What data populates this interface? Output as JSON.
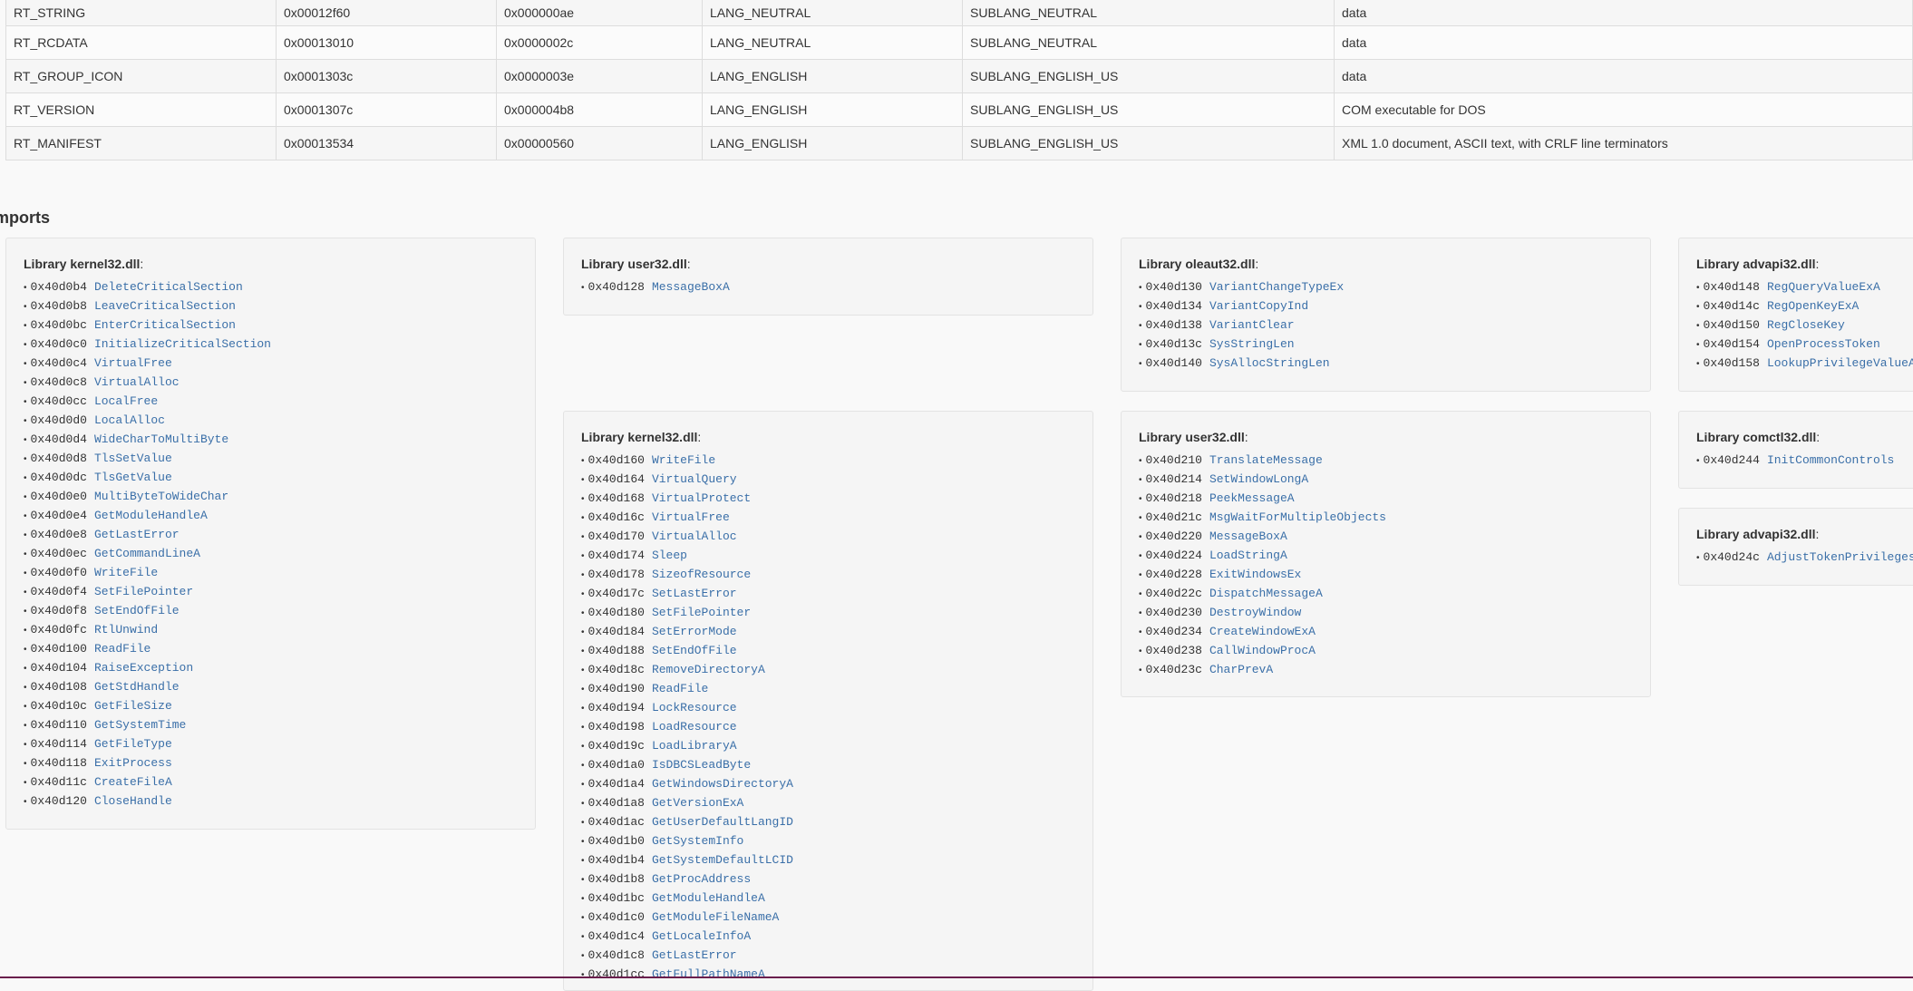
{
  "resources": [
    [
      "RT_STRING",
      "0x00012f60",
      "0x000000ae",
      "LANG_NEUTRAL",
      "SUBLANG_NEUTRAL",
      "data"
    ],
    [
      "RT_RCDATA",
      "0x00013010",
      "0x0000002c",
      "LANG_NEUTRAL",
      "SUBLANG_NEUTRAL",
      "data"
    ],
    [
      "RT_GROUP_ICON",
      "0x0001303c",
      "0x0000003e",
      "LANG_ENGLISH",
      "SUBLANG_ENGLISH_US",
      "data"
    ],
    [
      "RT_VERSION",
      "0x0001307c",
      "0x000004b8",
      "LANG_ENGLISH",
      "SUBLANG_ENGLISH_US",
      "COM executable for DOS"
    ],
    [
      "RT_MANIFEST",
      "0x00013534",
      "0x00000560",
      "LANG_ENGLISH",
      "SUBLANG_ENGLISH_US",
      "XML 1.0 document, ASCII text, with CRLF line terminators"
    ]
  ],
  "imports_heading": "mports",
  "library_prefix": "Library ",
  "libraries": [
    {
      "name": "kernel32.dll",
      "entries": [
        [
          "0x40d0b4",
          "DeleteCriticalSection"
        ],
        [
          "0x40d0b8",
          "LeaveCriticalSection"
        ],
        [
          "0x40d0bc",
          "EnterCriticalSection"
        ],
        [
          "0x40d0c0",
          "InitializeCriticalSection"
        ],
        [
          "0x40d0c4",
          "VirtualFree"
        ],
        [
          "0x40d0c8",
          "VirtualAlloc"
        ],
        [
          "0x40d0cc",
          "LocalFree"
        ],
        [
          "0x40d0d0",
          "LocalAlloc"
        ],
        [
          "0x40d0d4",
          "WideCharToMultiByte"
        ],
        [
          "0x40d0d8",
          "TlsSetValue"
        ],
        [
          "0x40d0dc",
          "TlsGetValue"
        ],
        [
          "0x40d0e0",
          "MultiByteToWideChar"
        ],
        [
          "0x40d0e4",
          "GetModuleHandleA"
        ],
        [
          "0x40d0e8",
          "GetLastError"
        ],
        [
          "0x40d0ec",
          "GetCommandLineA"
        ],
        [
          "0x40d0f0",
          "WriteFile"
        ],
        [
          "0x40d0f4",
          "SetFilePointer"
        ],
        [
          "0x40d0f8",
          "SetEndOfFile"
        ],
        [
          "0x40d0fc",
          "RtlUnwind"
        ],
        [
          "0x40d100",
          "ReadFile"
        ],
        [
          "0x40d104",
          "RaiseException"
        ],
        [
          "0x40d108",
          "GetStdHandle"
        ],
        [
          "0x40d10c",
          "GetFileSize"
        ],
        [
          "0x40d110",
          "GetSystemTime"
        ],
        [
          "0x40d114",
          "GetFileType"
        ],
        [
          "0x40d118",
          "ExitProcess"
        ],
        [
          "0x40d11c",
          "CreateFileA"
        ],
        [
          "0x40d120",
          "CloseHandle"
        ]
      ]
    },
    {
      "name": "user32.dll",
      "entries": [
        [
          "0x40d128",
          "MessageBoxA"
        ]
      ]
    },
    {
      "name": "oleaut32.dll",
      "entries": [
        [
          "0x40d130",
          "VariantChangeTypeEx"
        ],
        [
          "0x40d134",
          "VariantCopyInd"
        ],
        [
          "0x40d138",
          "VariantClear"
        ],
        [
          "0x40d13c",
          "SysStringLen"
        ],
        [
          "0x40d140",
          "SysAllocStringLen"
        ]
      ]
    },
    {
      "name": "advapi32.dll",
      "entries": [
        [
          "0x40d148",
          "RegQueryValueExA"
        ],
        [
          "0x40d14c",
          "RegOpenKeyExA"
        ],
        [
          "0x40d150",
          "RegCloseKey"
        ],
        [
          "0x40d154",
          "OpenProcessToken"
        ],
        [
          "0x40d158",
          "LookupPrivilegeValueA"
        ]
      ]
    },
    {
      "name": "kernel32.dll",
      "entries": [
        [
          "0x40d160",
          "WriteFile"
        ],
        [
          "0x40d164",
          "VirtualQuery"
        ],
        [
          "0x40d168",
          "VirtualProtect"
        ],
        [
          "0x40d16c",
          "VirtualFree"
        ],
        [
          "0x40d170",
          "VirtualAlloc"
        ],
        [
          "0x40d174",
          "Sleep"
        ],
        [
          "0x40d178",
          "SizeofResource"
        ],
        [
          "0x40d17c",
          "SetLastError"
        ],
        [
          "0x40d180",
          "SetFilePointer"
        ],
        [
          "0x40d184",
          "SetErrorMode"
        ],
        [
          "0x40d188",
          "SetEndOfFile"
        ],
        [
          "0x40d18c",
          "RemoveDirectoryA"
        ],
        [
          "0x40d190",
          "ReadFile"
        ],
        [
          "0x40d194",
          "LockResource"
        ],
        [
          "0x40d198",
          "LoadResource"
        ],
        [
          "0x40d19c",
          "LoadLibraryA"
        ],
        [
          "0x40d1a0",
          "IsDBCSLeadByte"
        ],
        [
          "0x40d1a4",
          "GetWindowsDirectoryA"
        ],
        [
          "0x40d1a8",
          "GetVersionExA"
        ],
        [
          "0x40d1ac",
          "GetUserDefaultLangID"
        ],
        [
          "0x40d1b0",
          "GetSystemInfo"
        ],
        [
          "0x40d1b4",
          "GetSystemDefaultLCID"
        ],
        [
          "0x40d1b8",
          "GetProcAddress"
        ],
        [
          "0x40d1bc",
          "GetModuleHandleA"
        ],
        [
          "0x40d1c0",
          "GetModuleFileNameA"
        ],
        [
          "0x40d1c4",
          "GetLocaleInfoA"
        ],
        [
          "0x40d1c8",
          "GetLastError"
        ],
        [
          "0x40d1cc",
          "GetFullPathNameA"
        ]
      ]
    },
    {
      "name": "user32.dll",
      "entries": [
        [
          "0x40d210",
          "TranslateMessage"
        ],
        [
          "0x40d214",
          "SetWindowLongA"
        ],
        [
          "0x40d218",
          "PeekMessageA"
        ],
        [
          "0x40d21c",
          "MsgWaitForMultipleObjects"
        ],
        [
          "0x40d220",
          "MessageBoxA"
        ],
        [
          "0x40d224",
          "LoadStringA"
        ],
        [
          "0x40d228",
          "ExitWindowsEx"
        ],
        [
          "0x40d22c",
          "DispatchMessageA"
        ],
        [
          "0x40d230",
          "DestroyWindow"
        ],
        [
          "0x40d234",
          "CreateWindowExA"
        ],
        [
          "0x40d238",
          "CallWindowProcA"
        ],
        [
          "0x40d23c",
          "CharPrevA"
        ]
      ]
    },
    {
      "name": "comctl32.dll",
      "entries": [
        [
          "0x40d244",
          "InitCommonControls"
        ]
      ]
    },
    {
      "name": "advapi32.dll",
      "entries": [
        [
          "0x40d24c",
          "AdjustTokenPrivileges"
        ]
      ]
    }
  ]
}
